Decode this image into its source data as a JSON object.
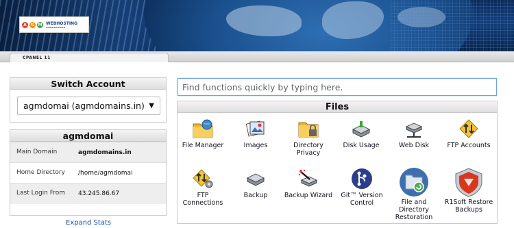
{
  "header": {
    "logo_text": "WEBHOSTING",
    "logo_letters": [
      "A",
      "G",
      "M"
    ],
    "tab_label": "CPANEL 11"
  },
  "switch_account": {
    "title": "Switch Account",
    "selected": "agmdomai (agmdomains.in)"
  },
  "account": {
    "title": "agmdomai",
    "rows": [
      {
        "label": "Main Domain",
        "value": "agmdomains.in"
      },
      {
        "label": "Home Directory",
        "value": "/home/agmdomai"
      },
      {
        "label": "Last Login From",
        "value": "43.245.86.67"
      }
    ],
    "expand_label": "Expand Stats"
  },
  "search": {
    "placeholder": "Find functions quickly by typing here."
  },
  "files": {
    "title": "Files",
    "items": [
      {
        "label": "File Manager",
        "icon": "folder-globe-icon"
      },
      {
        "label": "Images",
        "icon": "images-icon"
      },
      {
        "label": "Directory Privacy",
        "icon": "folder-lock-icon"
      },
      {
        "label": "Disk Usage",
        "icon": "disk-usage-icon"
      },
      {
        "label": "Web Disk",
        "icon": "web-disk-icon"
      },
      {
        "label": "FTP Accounts",
        "icon": "ftp-accounts-icon"
      },
      {
        "label": "FTP Connections",
        "icon": "ftp-connections-icon"
      },
      {
        "label": "Backup",
        "icon": "backup-icon"
      },
      {
        "label": "Backup Wizard",
        "icon": "backup-wizard-icon"
      },
      {
        "label": "Git™ Version Control",
        "icon": "git-icon"
      },
      {
        "label": "File and Directory Restoration",
        "icon": "restore-icon"
      },
      {
        "label": "R1Soft Restore Backups",
        "icon": "r1soft-icon"
      }
    ]
  },
  "colors": {
    "banner": "#123e78",
    "link": "#1a4fa0",
    "search_border": "#6fa6d6",
    "git_blue": "#2b3e8c",
    "restore_blue": "#3d6fb0",
    "r1soft_red": "#d9361e"
  }
}
